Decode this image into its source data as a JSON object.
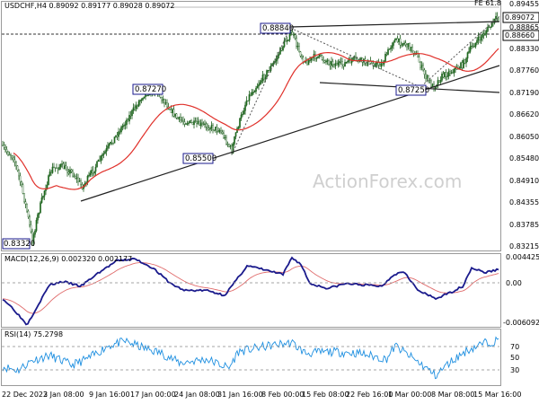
{
  "watermark": "ActionForex.com",
  "chart_data": [
    {
      "type": "candlestick",
      "title": "USDCHF,H4  0.89092 0.89177 0.89028 0.89072",
      "ylim": [
        0.8315,
        0.895
      ],
      "yticks": [
        "0.89455",
        "0.88865",
        "0.88330",
        "0.87760",
        "0.87190",
        "0.86620",
        "0.86050",
        "0.85480",
        "0.84910",
        "0.84355",
        "0.83785",
        "0.83215"
      ],
      "last_price": "0.89072",
      "fib_label": "FE 61.8",
      "fib_level": 0.8946,
      "dashed_level": "0.88660",
      "annotations": [
        "0.88840",
        "0.87270",
        "0.85500",
        "0.87250",
        "0.83320"
      ],
      "ma_color": "#e0302a",
      "trendlines": "black",
      "xticks": [
        "22 Dec 2023",
        "2 Jan 08:00",
        "9 Jan 16:00",
        "17 Jan 00:00",
        "24 Jan 08:00",
        "31 Jan 16:00",
        "8 Feb 00:00",
        "15 Feb 08:00",
        "22 Feb 16:00",
        "1 Mar 00:00",
        "8 Mar 08:00",
        "15 Mar 16:00"
      ]
    },
    {
      "type": "line",
      "title": "MACD(12,26,9) 0.002320 0.002177",
      "yticks": [
        "0.004425",
        "0.00",
        "-0.006092"
      ],
      "ylim": [
        -0.0061,
        0.0045
      ],
      "series": [
        {
          "name": "MACD",
          "color": "#1a1a8c"
        },
        {
          "name": "Signal",
          "color": "#e06c6c"
        }
      ]
    },
    {
      "type": "line",
      "title": "RSI(14) 75.2798",
      "yticks": [
        "70",
        "50",
        "30"
      ],
      "ylim": [
        15,
        90
      ],
      "series": [
        {
          "name": "RSI",
          "color": "#1e8fe0"
        }
      ]
    }
  ]
}
